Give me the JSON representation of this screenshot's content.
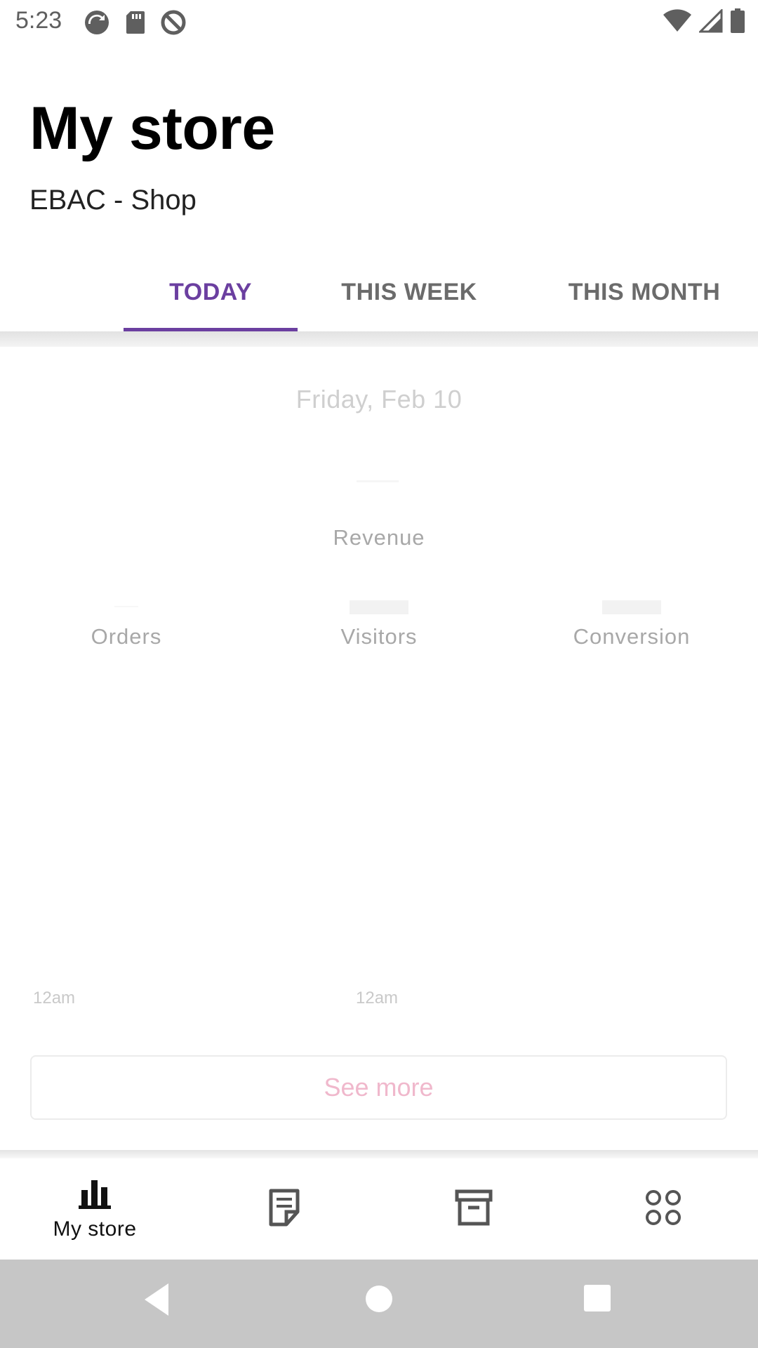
{
  "status_bar": {
    "time": "5:23",
    "left_icons": [
      "sync-icon",
      "sd-card-icon",
      "do-not-disturb-icon"
    ],
    "right_icons": [
      "wifi-icon",
      "signal-icon",
      "battery-icon"
    ]
  },
  "header": {
    "title": "My store",
    "subtitle": "EBAC - Shop"
  },
  "tabs": [
    {
      "label": "TODAY",
      "active": true
    },
    {
      "label": "THIS WEEK",
      "active": false
    },
    {
      "label": "THIS MONTH",
      "active": false
    }
  ],
  "stats": {
    "date": "Friday, Feb 10",
    "revenue_label": "Revenue",
    "orders_label": "Orders",
    "visitors_label": "Visitors",
    "conversion_label": "Conversion"
  },
  "chart": {
    "x_ticks": [
      "12am",
      "12am"
    ]
  },
  "see_more_label": "See more",
  "bottom_nav": [
    {
      "label": "My store",
      "icon": "bar-chart-icon",
      "selected": true
    },
    {
      "label": "",
      "icon": "orders-icon",
      "selected": false
    },
    {
      "label": "",
      "icon": "products-archive-icon",
      "selected": false
    },
    {
      "label": "",
      "icon": "menu-grid-icon",
      "selected": false
    }
  ],
  "colors": {
    "accent": "#6b3fa0",
    "see_more_text": "#f0b8cc",
    "system_nav_bg": "#c6c6c6"
  }
}
